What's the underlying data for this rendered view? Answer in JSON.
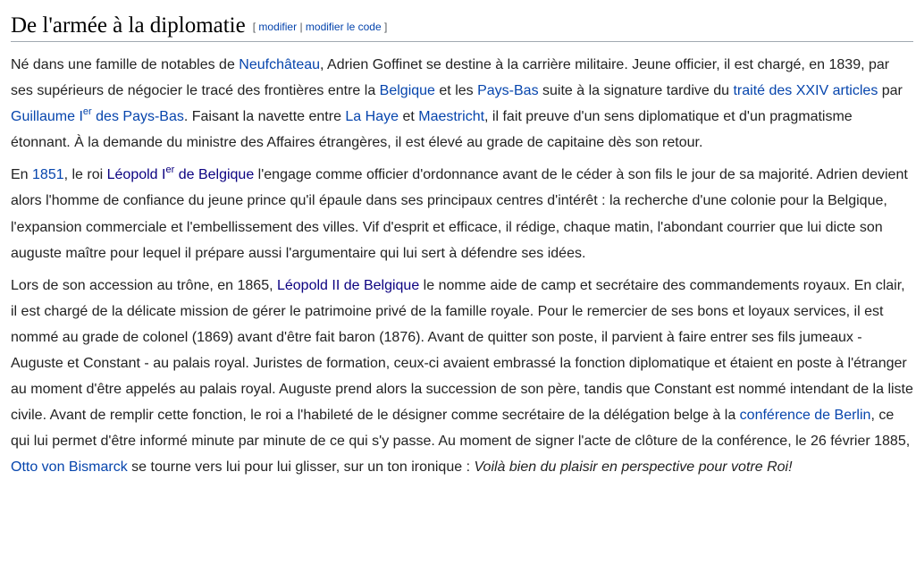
{
  "section": {
    "title": "De l'armée à la diplomatie",
    "edit_open": "[",
    "edit_label": "modifier",
    "edit_sep": "|",
    "edit_code_label": "modifier le code",
    "edit_close": "]"
  },
  "p1": {
    "t1": "Né dans une famille de notables de ",
    "l1": "Neufchâteau",
    "t2": ", Adrien Goffinet se destine à la carrière militaire. Jeune officier, il est chargé, en 1839, par ses supérieurs de négocier le tracé des frontières entre la ",
    "l2": "Belgique",
    "t3": " et les ",
    "l3": "Pays-Bas",
    "t4": " suite à la signature tardive du ",
    "l4": "traité des XXIV articles",
    "t5": " par ",
    "l5a": "Guillaume I",
    "l5sup": "er",
    "l5b": " des Pays-Bas",
    "t6": ". Faisant la navette entre ",
    "l6": "La Haye",
    "t7": " et ",
    "l7": "Maestricht",
    "t8": ", il fait preuve d'un sens diplomatique et d'un pragmatisme étonnant. À la demande du ministre des Affaires étrangères, il est élevé au grade de capitaine dès son retour."
  },
  "p2": {
    "t1": "En ",
    "l1": "1851",
    "t2": ", le roi ",
    "l2a": "Léopold I",
    "l2sup": "er",
    "l2b": " de Belgique",
    "t3": " l'engage comme officier d'ordonnance avant de le céder à son fils le jour de sa majorité. Adrien devient alors l'homme de confiance du jeune prince qu'il épaule dans ses principaux centres d'intérêt : la recherche d'une colonie pour la Belgique, l'expansion commerciale et l'embellissement des villes. Vif d'esprit et efficace, il rédige, chaque matin, l'abondant courrier que lui dicte son auguste maître pour lequel il prépare aussi l'argumentaire qui lui sert à défendre ses idées."
  },
  "p3": {
    "t1": "Lors de son accession au trône, en 1865, ",
    "l1": "Léopold II de Belgique",
    "t2": " le nomme aide de camp et secrétaire des commandements royaux. En clair, il est chargé de la délicate mission de gérer le patrimoine privé de la famille royale. Pour le remercier de ses bons et loyaux services, il est nommé au grade de colonel (1869) avant d'être fait baron (1876). Avant de quitter son poste, il parvient à faire entrer ses fils jumeaux - Auguste et Constant - au palais royal. Juristes de formation, ceux-ci avaient embrassé la fonction diplomatique et étaient en poste à l'étranger au moment d'être appelés au palais royal. Auguste prend alors la succession de son père, tandis que Constant est nommé intendant de la liste civile. Avant de remplir cette fonction, le roi a l'habileté de le désigner comme secrétaire de la délégation belge à la ",
    "l2": "conférence de Berlin",
    "t3": ", ce qui lui permet d'être informé minute par minute de ce qui s'y passe. Au moment de signer l'acte de clôture de la conférence, le 26 février 1885, ",
    "l3": "Otto von Bismarck",
    "t4": " se tourne vers lui pour lui glisser, sur un ton ironique : ",
    "quote": "Voilà bien du plaisir en perspective pour votre Roi!"
  },
  "colors": {
    "link": "#0645ad",
    "visited_link": "#0b0080",
    "text": "#222222",
    "rule": "#a2a9b1"
  }
}
